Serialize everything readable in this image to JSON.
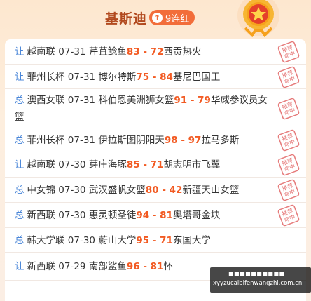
{
  "header": {
    "title": "基斯迪",
    "streak_label": "9连红",
    "streak_icon": "up-arrow-icon",
    "medal_icon": "star-medal-icon"
  },
  "picks": [
    {
      "tag": "让",
      "league": "越南联",
      "date": "07-31",
      "home": "芹苴鲶鱼",
      "home_score": "83",
      "sep": "-",
      "away_score": "72",
      "away": "西贡热火",
      "stamp": true
    },
    {
      "tag": "让",
      "league": "菲州长杯",
      "date": "07-31",
      "home": "博尔特斯",
      "home_score": "75",
      "sep": "-",
      "away_score": "84",
      "away": "基尼巴国王",
      "stamp": true
    },
    {
      "tag": "总",
      "league": "澳西女联",
      "date": "07-31",
      "home": "科伯恩美洲狮女篮",
      "home_score": "91",
      "sep": "-",
      "away_score": "79",
      "away": "华威参议员女篮",
      "stamp": true
    },
    {
      "tag": "总",
      "league": "菲州长杯",
      "date": "07-31",
      "home": "伊拉斯图阴阳天",
      "home_score": "98",
      "sep": "-",
      "away_score": "97",
      "away": "拉马多斯",
      "stamp": true
    },
    {
      "tag": "让",
      "league": "越南联",
      "date": "07-30",
      "home": "芽庄海豚",
      "home_score": "85",
      "sep": "-",
      "away_score": "71",
      "away": "胡志明市飞翼",
      "stamp": true
    },
    {
      "tag": "总",
      "league": "中女锦",
      "date": "07-30",
      "home": "武汉盛帆女篮",
      "home_score": "80",
      "sep": "-",
      "away_score": "42",
      "away": "新疆天山女篮",
      "stamp": true
    },
    {
      "tag": "总",
      "league": "新西联",
      "date": "07-30",
      "home": "惠灵顿圣徒",
      "home_score": "94",
      "sep": "-",
      "away_score": "81",
      "away": "奥塔哥金块",
      "stamp": true
    },
    {
      "tag": "总",
      "league": "韩大学联",
      "date": "07-30",
      "home": "蔚山大学",
      "home_score": "95",
      "sep": "-",
      "away_score": "71",
      "away": "东国大学",
      "stamp": false
    },
    {
      "tag": "让",
      "league": "新西联",
      "date": "07-29",
      "home": "南部鲨鱼",
      "home_score": "96",
      "sep": "-",
      "away_score": "81",
      "away": "怀",
      "stamp": false
    }
  ],
  "stamp_label": "推荐命中",
  "colors": {
    "accent": "#f25a22",
    "tag": "#4a86d8",
    "title": "#b24a1f",
    "streak_bg": "#f26d3a",
    "stamp": "#e05a5a"
  },
  "watermark": {
    "line1": "■■■■■■■■■■",
    "line2": "xyyzucaibifenwangzhi.com.cn"
  }
}
